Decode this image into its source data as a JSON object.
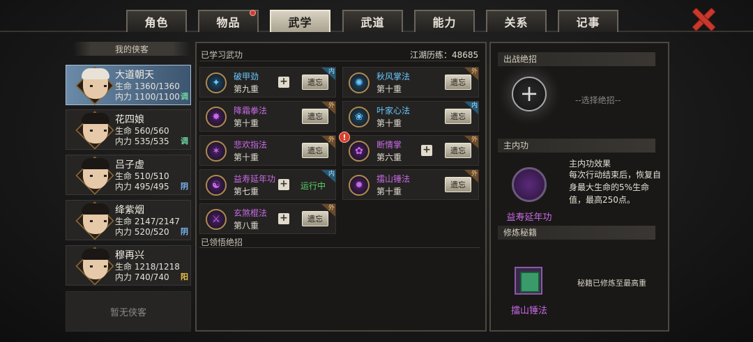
{
  "tabs": [
    {
      "label": "角色",
      "active": false,
      "badge": false
    },
    {
      "label": "物品",
      "active": false,
      "badge": true
    },
    {
      "label": "武学",
      "active": true,
      "badge": false
    },
    {
      "label": "武道",
      "active": false,
      "badge": false
    },
    {
      "label": "能力",
      "active": false,
      "badge": false
    },
    {
      "label": "关系",
      "active": false,
      "badge": false
    },
    {
      "label": "记事",
      "active": false,
      "badge": false
    }
  ],
  "left": {
    "header": "我的侠客",
    "heroes": [
      {
        "name": "大道朝天",
        "hp": "生命 1360/1360",
        "mp": "内力 1100/1100",
        "tag": "调",
        "tag_color": "#6fd3a0"
      },
      {
        "name": "花四娘",
        "hp": "生命 560/560",
        "mp": "内力 535/535",
        "tag": "调",
        "tag_color": "#6fd3a0"
      },
      {
        "name": "吕子虚",
        "hp": "生命 510/510",
        "mp": "内力 495/495",
        "tag": "阴",
        "tag_color": "#7ab4f0"
      },
      {
        "name": "绛紫烟",
        "hp": "生命 2147/2147",
        "mp": "内力 520/520",
        "tag": "阴",
        "tag_color": "#7ab4f0"
      },
      {
        "name": "穆再兴",
        "hp": "生命 1218/1218",
        "mp": "内力 740/740",
        "tag": "阳",
        "tag_color": "#e8c24a"
      }
    ],
    "empty_label": "暂无侠客"
  },
  "center": {
    "title": "已学习武功",
    "exp": "江湖历练：48685",
    "skills": [
      {
        "name": "破甲劲",
        "level": "第九重",
        "color": "#6ac8ff",
        "type": "内",
        "plus": true,
        "action": "遗忘",
        "warn": false
      },
      {
        "name": "秋风掌法",
        "level": "第十重",
        "color": "#6ac8ff",
        "type": "外",
        "plus": false,
        "action": "遗忘",
        "warn": false
      },
      {
        "name": "降霜拳法",
        "level": "第十重",
        "color": "#c86ae6",
        "type": "外",
        "plus": false,
        "action": "遗忘",
        "warn": false
      },
      {
        "name": "叶家心法",
        "level": "第十重",
        "color": "#6ac8ff",
        "type": "内",
        "plus": false,
        "action": "遗忘",
        "warn": false
      },
      {
        "name": "悲欢指法",
        "level": "第十重",
        "color": "#c86ae6",
        "type": "外",
        "plus": false,
        "action": "遗忘",
        "warn": false
      },
      {
        "name": "断情掌",
        "level": "第六重",
        "color": "#c86ae6",
        "type": "外",
        "plus": true,
        "action": "遗忘",
        "warn": true
      },
      {
        "name": "益寿延年功",
        "level": "第七重",
        "color": "#c86ae6",
        "type": "内",
        "plus": true,
        "action": "运行中",
        "warn": false
      },
      {
        "name": "擂山锤法",
        "level": "第十重",
        "color": "#c86ae6",
        "type": "外",
        "plus": false,
        "action": "遗忘",
        "warn": false
      },
      {
        "name": "玄煞棍法",
        "level": "第八重",
        "color": "#c86ae6",
        "type": "外",
        "plus": true,
        "action": "遗忘",
        "warn": false
      }
    ],
    "ultimate_title": "已领悟绝招"
  },
  "right": {
    "ultimate_header": "出战绝招",
    "choose_text": "--选择绝招--",
    "main_header": "主内功",
    "effect_title": "主内功效果",
    "effect_desc": "每次行动结束后，恢复自身最大生命的5%生命值，最高250点。",
    "main_name": "益寿延年功",
    "train_header": "修炼秘籍",
    "book_name": "擂山锤法",
    "book_status": "秘籍已修炼至最高重"
  }
}
